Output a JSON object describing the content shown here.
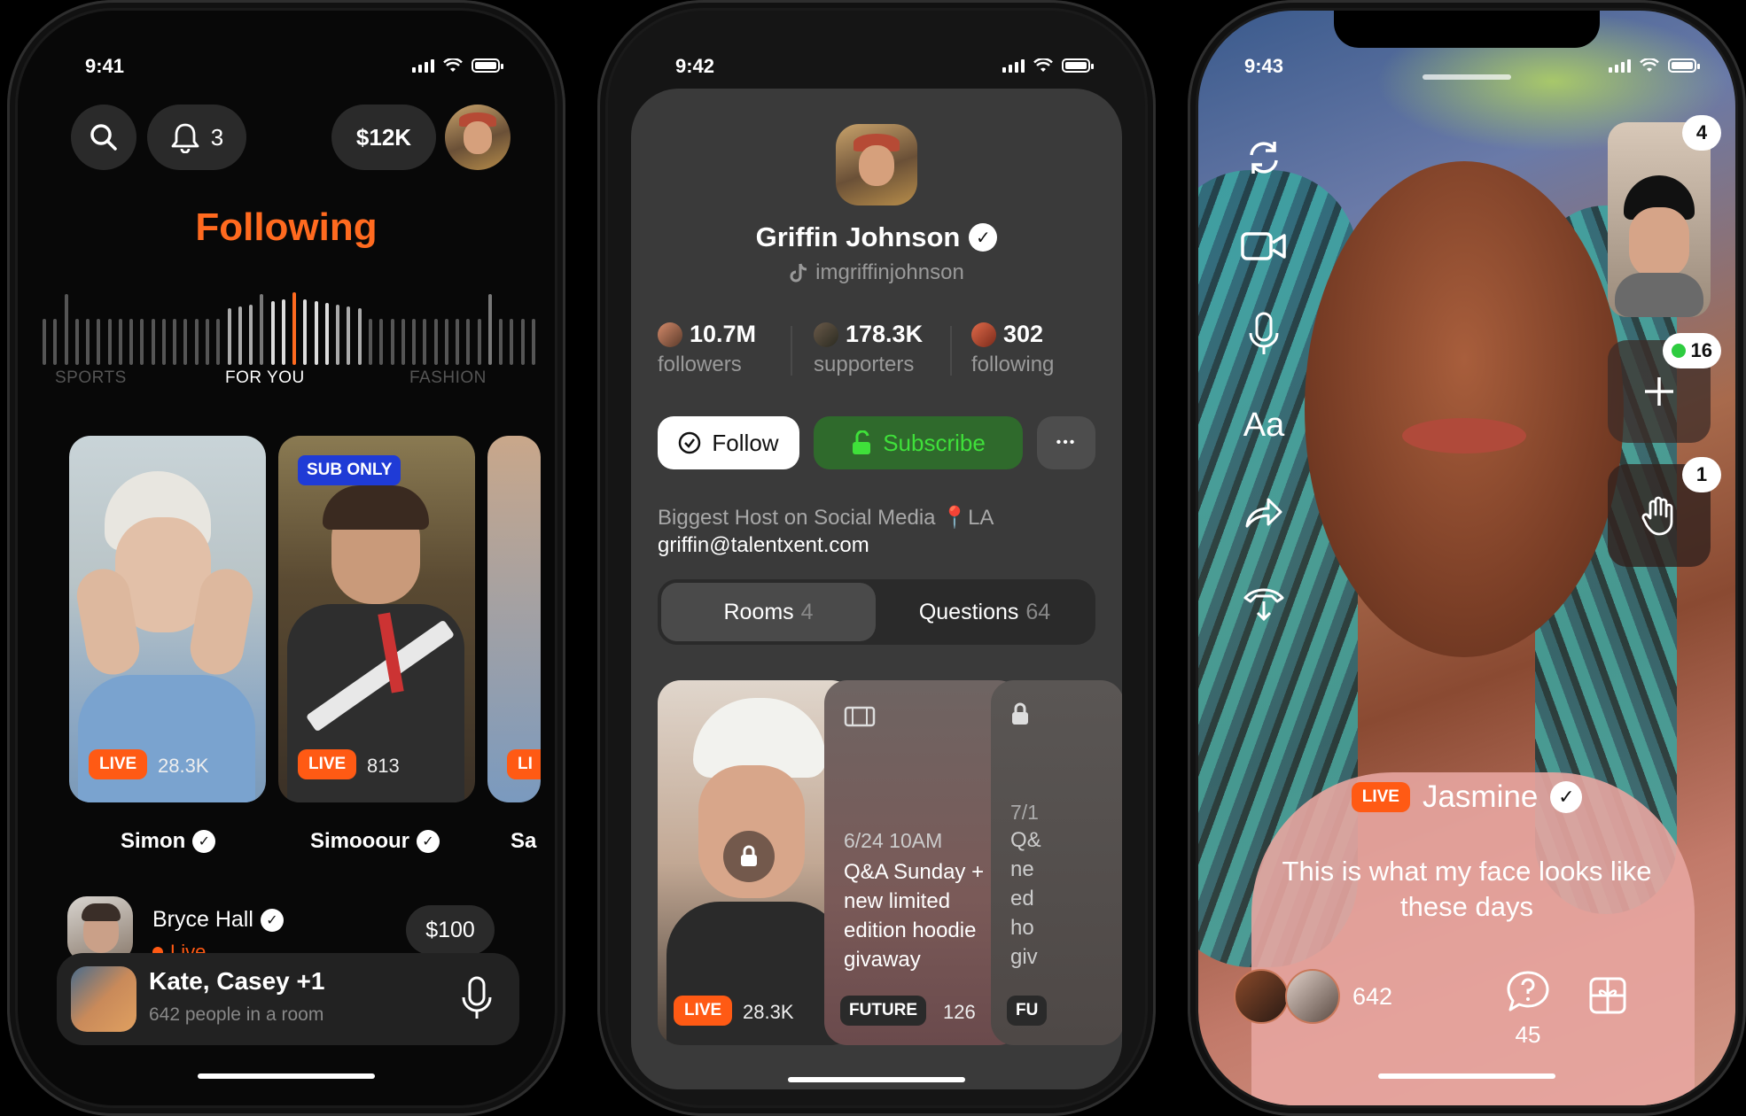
{
  "phone1": {
    "status_time": "9:41",
    "notifications_count": "3",
    "balance": "$12K",
    "title": "Following",
    "categories": [
      "SPORTS",
      "FOR YOU",
      "FASHION"
    ],
    "cards": [
      {
        "name": "Simon",
        "badge": "LIVE",
        "viewers": "28.3K",
        "sub_only": ""
      },
      {
        "name": "Simooour",
        "badge": "LIVE",
        "viewers": "813",
        "sub_only": "SUB ONLY"
      },
      {
        "name": "Sa",
        "badge": "LI",
        "viewers": "",
        "sub_only": ""
      }
    ],
    "list_item": {
      "name": "Bryce Hall",
      "status": "Live",
      "price": "$100"
    },
    "room_bar": {
      "title": "Kate, Casey +1",
      "subtitle": "642 people in a room"
    }
  },
  "phone2": {
    "status_time": "9:42",
    "name": "Griffin Johnson",
    "handle": "imgriffinjohnson",
    "stats": [
      {
        "value": "10.7M",
        "label": "followers"
      },
      {
        "value": "178.3K",
        "label": "supporters"
      },
      {
        "value": "302",
        "label": "following"
      }
    ],
    "follow_label": "Follow",
    "subscribe_label": "Subscribe",
    "more_label": "•••",
    "bio_line1": "Biggest Host on Social Media",
    "bio_pin": "📍",
    "bio_location": "LA",
    "bio_email": "griffin@talentxent.com",
    "tabs": [
      {
        "label": "Rooms",
        "count": "4"
      },
      {
        "label": "Questions",
        "count": "64"
      }
    ],
    "rooms": [
      {
        "badge": "LIVE",
        "viewers": "28.3K"
      },
      {
        "date": "6/24 10AM",
        "title": "Q&A Sunday + new limited edition hoodie givaway",
        "badge": "FUTURE",
        "count": "126"
      },
      {
        "date": "7/1",
        "title_lines": [
          "Q&",
          "ne",
          "ed",
          "ho",
          "giv"
        ],
        "badge": "FU"
      }
    ]
  },
  "phone3": {
    "status_time": "9:43",
    "side_tools": [
      "refresh-icon",
      "video-icon",
      "mic-icon",
      "text-icon",
      "share-icon",
      "hangup-icon"
    ],
    "text_tool_label": "Aa",
    "stack": {
      "viewers_badge": "4",
      "requests_badge": "16",
      "hands_badge": "1"
    },
    "badge": "LIVE",
    "name": "Jasmine",
    "caption": "This is what my face looks like these days",
    "listener_count": "642",
    "questions_count": "45",
    "colors": {
      "accent": "#ff5a14",
      "green": "#2ecc40"
    }
  }
}
